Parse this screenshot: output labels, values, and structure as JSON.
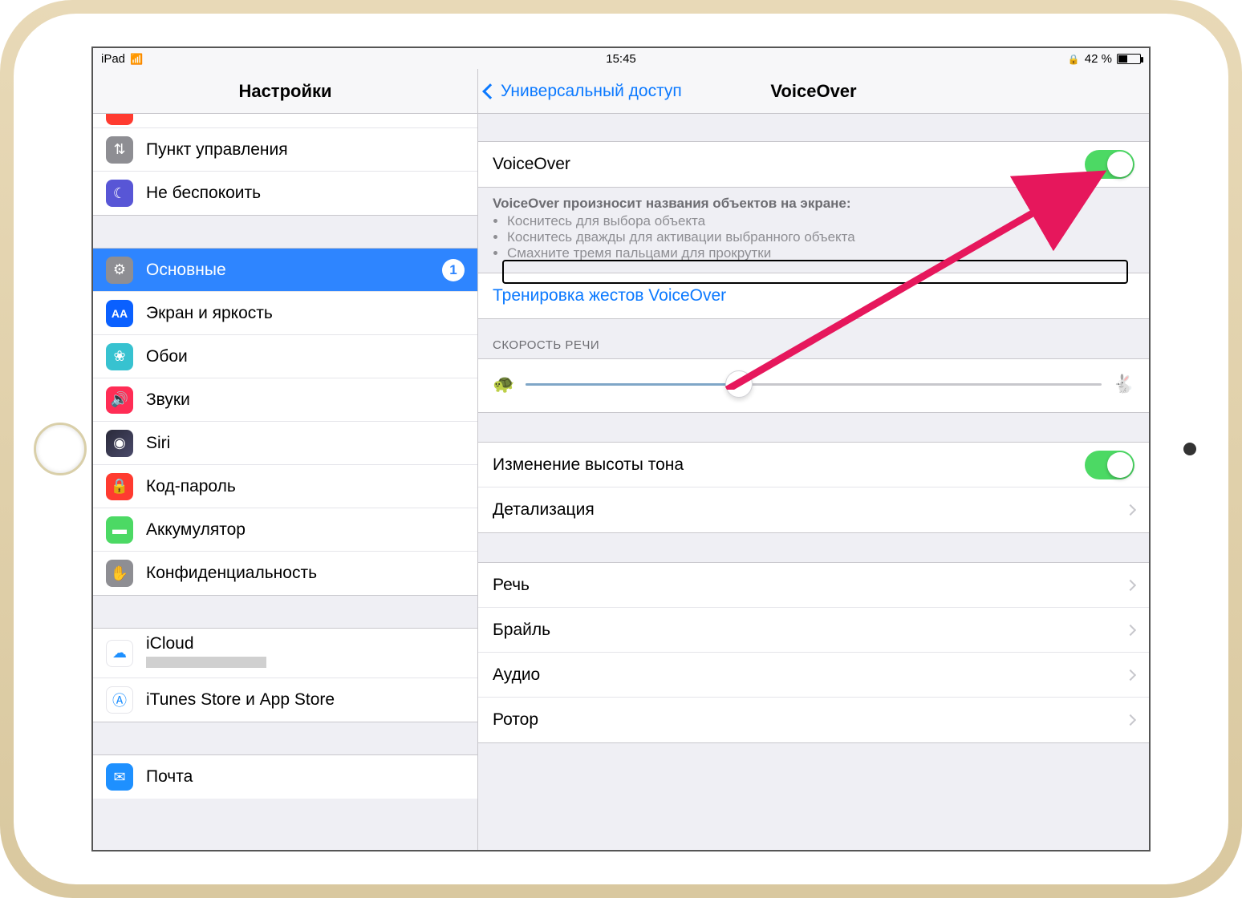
{
  "statusbar": {
    "device": "iPad",
    "time": "15:45",
    "battery_pct": "42 %"
  },
  "sidebar": {
    "title": "Настройки",
    "items": [
      {
        "label": "Пункт управления",
        "icon": "control-icon",
        "cls": "ic-control",
        "glyph": "⇅"
      },
      {
        "label": "Не беспокоить",
        "icon": "moon-icon",
        "cls": "ic-dnd",
        "glyph": "☾"
      },
      {
        "label": "Основные",
        "icon": "gear-icon",
        "cls": "ic-general",
        "glyph": "⚙",
        "selected": true,
        "badge": "1"
      },
      {
        "label": "Экран и яркость",
        "icon": "display-icon",
        "cls": "ic-display",
        "glyph": "AA"
      },
      {
        "label": "Обои",
        "icon": "wallpaper-icon",
        "cls": "ic-wall",
        "glyph": "❀"
      },
      {
        "label": "Звуки",
        "icon": "speaker-icon",
        "cls": "ic-sound",
        "glyph": "🔊"
      },
      {
        "label": "Siri",
        "icon": "siri-icon",
        "cls": "ic-siri",
        "glyph": "◉"
      },
      {
        "label": "Код-пароль",
        "icon": "lock-icon",
        "cls": "ic-pass",
        "glyph": "🔒"
      },
      {
        "label": "Аккумулятор",
        "icon": "battery-icon",
        "cls": "ic-batt",
        "glyph": "▬"
      },
      {
        "label": "Конфиденциальность",
        "icon": "hand-icon",
        "cls": "ic-priv",
        "glyph": "✋"
      },
      {
        "label": "iCloud",
        "icon": "cloud-icon",
        "cls": "ic-icloud",
        "glyph": "☁"
      },
      {
        "label": "iTunes Store и App Store",
        "icon": "appstore-icon",
        "cls": "ic-app",
        "glyph": "Ⓐ"
      },
      {
        "label": "Почта",
        "icon": "mail-icon",
        "cls": "ic-mail",
        "glyph": "✉"
      }
    ]
  },
  "main": {
    "back": "Универсальный доступ",
    "title": "VoiceOver",
    "voiceover_label": "VoiceOver",
    "voiceover_on": true,
    "desc_title": "VoiceOver произносит названия объектов на экране:",
    "desc_items": [
      "Коснитесь для выбора объекта",
      "Коснитесь дважды для активации выбранного объекта",
      "Смахните тремя пальцами для прокрутки"
    ],
    "practice": "Тренировка жестов VoiceOver",
    "speed_header": "СКОРОСТЬ РЕЧИ",
    "slider_pct": 37,
    "pitch_label": "Изменение высоты тона",
    "pitch_on": true,
    "detail_label": "Детализация",
    "rows4": [
      "Речь",
      "Брайль",
      "Аудио",
      "Ротор"
    ]
  }
}
